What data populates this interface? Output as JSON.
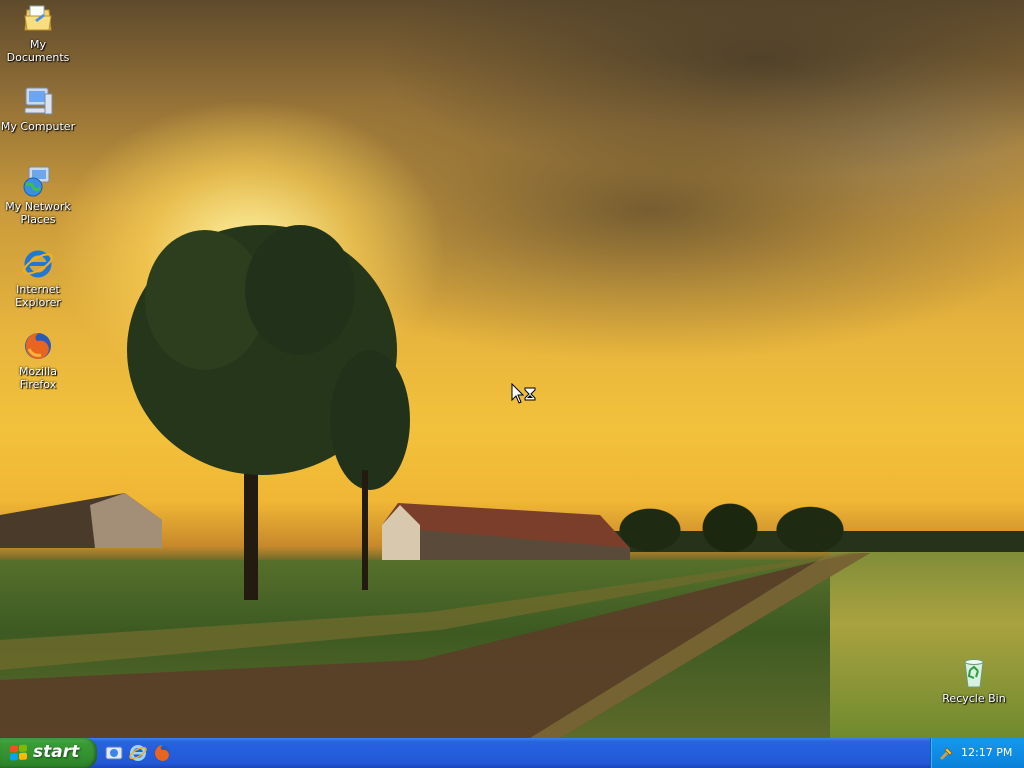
{
  "desktop": {
    "icons": [
      {
        "label": "My Documents",
        "icon": "my-documents-icon"
      },
      {
        "label": "My Computer",
        "icon": "my-computer-icon"
      },
      {
        "label": "My Network Places",
        "icon": "network-places-icon"
      },
      {
        "label": "Internet Explorer",
        "icon": "internet-explorer-icon"
      },
      {
        "label": "Mozilla Firefox",
        "icon": "firefox-icon"
      },
      {
        "label": "Recycle Bin",
        "icon": "recycle-bin-icon"
      }
    ]
  },
  "taskbar": {
    "start_label": "start",
    "quick_launch": [
      "show-desktop-icon",
      "internet-explorer-icon",
      "firefox-icon"
    ],
    "tray_icons": [
      "tray-utility-icon"
    ],
    "clock": "12:17 PM"
  },
  "cursor": "busy-arrow-hourglass-icon",
  "colors": {
    "taskbar": "#245edb",
    "start_button": "#3a9a36",
    "tray": "#0f8de6"
  }
}
